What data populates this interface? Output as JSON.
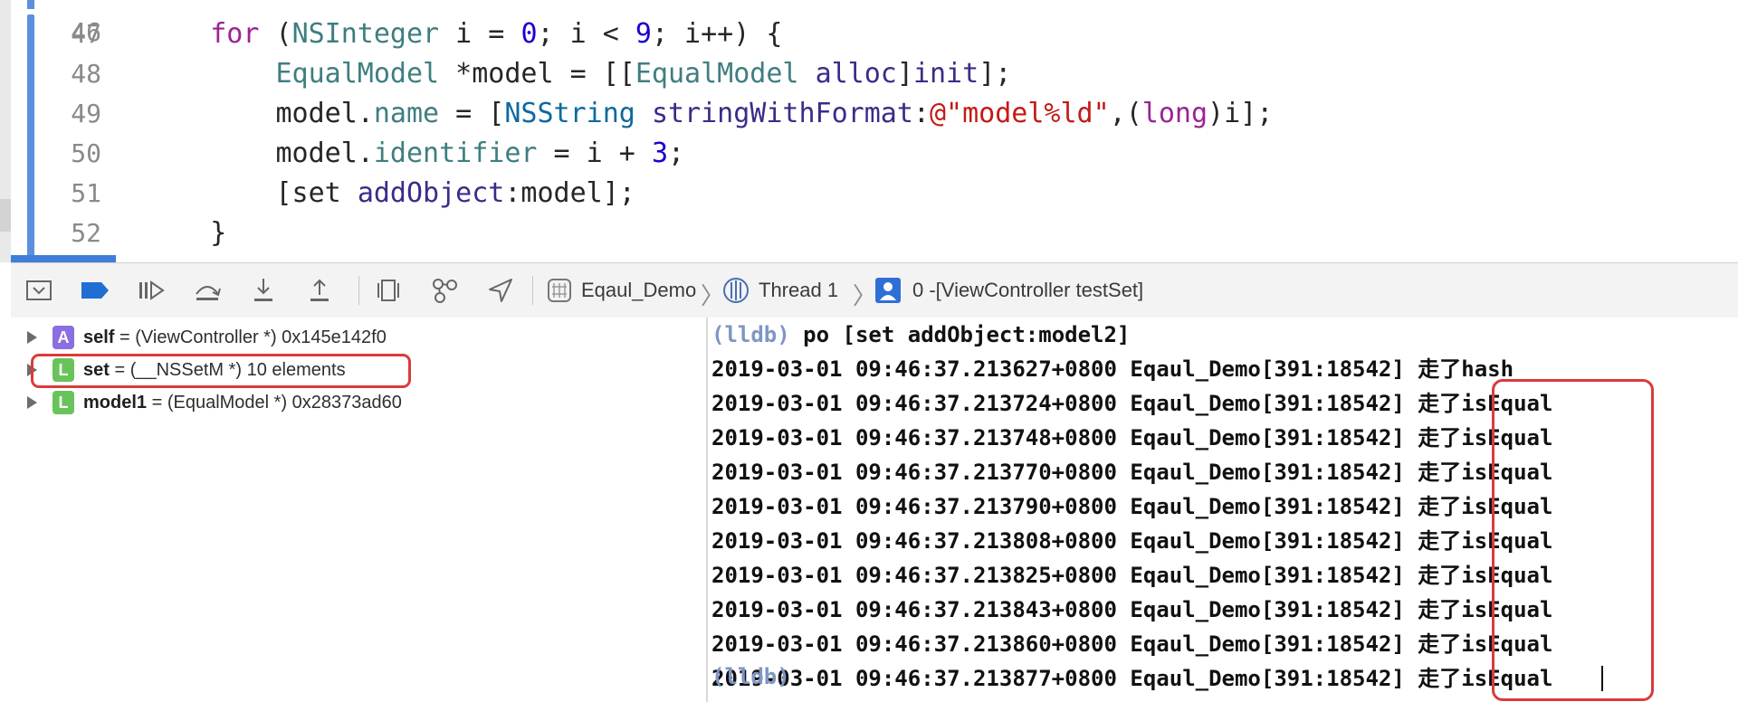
{
  "editor": {
    "partial_top_line_number": "46",
    "lines": [
      {
        "num": "47",
        "tokens": [
          [
            "    ",
            "plain"
          ],
          [
            "for",
            "keyword"
          ],
          [
            " (",
            "plain"
          ],
          [
            "NSInteger",
            "type"
          ],
          [
            " i = ",
            "plain"
          ],
          [
            "0",
            "number"
          ],
          [
            "; i < ",
            "plain"
          ],
          [
            "9",
            "number"
          ],
          [
            "; i++) {",
            "plain"
          ]
        ]
      },
      {
        "num": "48",
        "tokens": [
          [
            "        ",
            "plain"
          ],
          [
            "EqualModel",
            "type"
          ],
          [
            " *model = [[",
            "plain"
          ],
          [
            "EqualModel",
            "type"
          ],
          [
            " ",
            "plain"
          ],
          [
            "alloc",
            "method"
          ],
          [
            "]",
            "plain"
          ],
          [
            "init",
            "method"
          ],
          [
            "];",
            "plain"
          ]
        ]
      },
      {
        "num": "49",
        "tokens": [
          [
            "        model.",
            "plain"
          ],
          [
            "name",
            "prop"
          ],
          [
            " = [",
            "plain"
          ],
          [
            "NSString",
            "class"
          ],
          [
            " ",
            "plain"
          ],
          [
            "stringWithFormat",
            "method"
          ],
          [
            ":",
            "plain"
          ],
          [
            "@\"model%ld\"",
            "string"
          ],
          [
            ",(",
            "plain"
          ],
          [
            "long",
            "keyword"
          ],
          [
            ")i];",
            "plain"
          ]
        ]
      },
      {
        "num": "50",
        "tokens": [
          [
            "        model.",
            "plain"
          ],
          [
            "identifier",
            "prop"
          ],
          [
            " = i + ",
            "plain"
          ],
          [
            "3",
            "number"
          ],
          [
            ";",
            "plain"
          ]
        ]
      },
      {
        "num": "51",
        "tokens": [
          [
            "        [set ",
            "plain"
          ],
          [
            "addObject",
            "method"
          ],
          [
            ":model];",
            "plain"
          ]
        ]
      },
      {
        "num": "52",
        "tokens": [
          [
            "    }",
            "plain"
          ]
        ]
      }
    ]
  },
  "debugbar": {
    "buttons": [
      {
        "name": "hide-debug-area-icon"
      },
      {
        "name": "breakpoints-toggle-icon"
      },
      {
        "name": "continue-icon"
      },
      {
        "name": "step-over-icon"
      },
      {
        "name": "step-into-icon"
      },
      {
        "name": "step-out-icon"
      },
      {
        "name": "view-debugger-icon"
      },
      {
        "name": "memory-graph-icon"
      },
      {
        "name": "simulate-location-icon"
      }
    ],
    "breadcrumbs": {
      "app": "Eqaul_Demo",
      "thread": "Thread 1",
      "frame": "0 -[ViewController testSet]"
    },
    "accent_color": "#1f6ed4"
  },
  "variables": [
    {
      "badge": "A",
      "badge_color": "#8b6ee0",
      "name": "self",
      "value": " = (ViewController *) 0x145e142f0"
    },
    {
      "badge": "L",
      "badge_color": "#68c45a",
      "name": "set",
      "value": " = (__NSSetM *) 10 elements",
      "highlighted": true
    },
    {
      "badge": "L",
      "badge_color": "#68c45a",
      "name": "model1",
      "value": " = (EqualModel *) 0x28373ad60"
    }
  ],
  "console": {
    "prompt": "(lldb)",
    "command": " po [set addObject:model2]",
    "log_prefix": "Eqaul_Demo[391:18542]",
    "lines": [
      {
        "time": "2019-03-01 09:46:37.213627+0800",
        "message": "走了hash"
      },
      {
        "time": "2019-03-01 09:46:37.213724+0800",
        "message": "走了isEqual"
      },
      {
        "time": "2019-03-01 09:46:37.213748+0800",
        "message": "走了isEqual"
      },
      {
        "time": "2019-03-01 09:46:37.213770+0800",
        "message": "走了isEqual"
      },
      {
        "time": "2019-03-01 09:46:37.213790+0800",
        "message": "走了isEqual"
      },
      {
        "time": "2019-03-01 09:46:37.213808+0800",
        "message": "走了isEqual"
      },
      {
        "time": "2019-03-01 09:46:37.213825+0800",
        "message": "走了isEqual"
      },
      {
        "time": "2019-03-01 09:46:37.213843+0800",
        "message": "走了isEqual"
      },
      {
        "time": "2019-03-01 09:46:37.213860+0800",
        "message": "走了isEqual"
      },
      {
        "time": "2019-03-01 09:46:37.213877+0800",
        "message": "走了isEqual"
      }
    ],
    "trailing_prompt": "(lldb)",
    "highlight_color": "#db3b3b"
  }
}
